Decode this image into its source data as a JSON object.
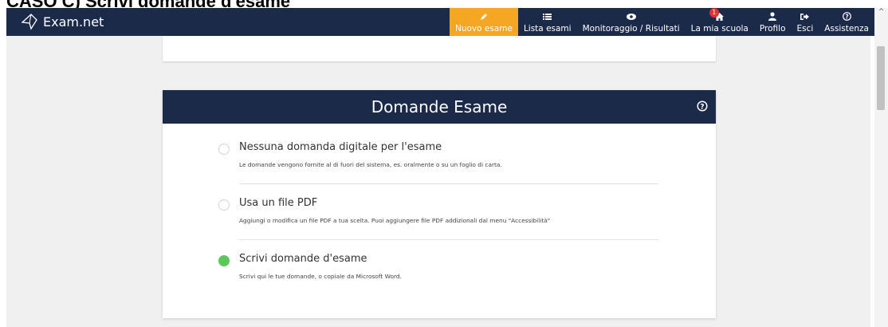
{
  "document": {
    "heading": "CASO C) Scrivi domande d'esame"
  },
  "app": {
    "logo_text": "Exam.net"
  },
  "nav": {
    "items": [
      {
        "label": "Nuovo esame",
        "icon": "pencil-icon"
      },
      {
        "label": "Lista esami",
        "icon": "list-icon"
      },
      {
        "label": "Monitoraggio / Risultati",
        "icon": "eye-icon"
      },
      {
        "label": "La mia scuola",
        "icon": "home-icon",
        "badge": "1"
      },
      {
        "label": "Profilo",
        "icon": "user-icon"
      },
      {
        "label": "Esci",
        "icon": "sign-out-icon"
      },
      {
        "label": "Assistenza",
        "icon": "help-circle-icon"
      }
    ],
    "active_index": 0
  },
  "section": {
    "title": "Domande Esame",
    "help_icon": "help-circle-icon",
    "options": [
      {
        "title": "Nessuna domanda digitale per l'esame",
        "description": "Le domande vengono fornite al di fuori del sistema, es. oralmente o su un foglio di carta.",
        "selected": false
      },
      {
        "title": "Usa un file PDF",
        "description": "Aggiungi o modifica un file PDF a tua scelta. Puoi aggiungere file PDF addizionali dal menu \"Accessibilità\"",
        "selected": false
      },
      {
        "title": "Scrivi domande d'esame",
        "description": "Scrivi qui le tue domande, o copiale da Microsoft Word.",
        "selected": true
      }
    ]
  },
  "colors": {
    "nav_bg": "#1c2a4a",
    "active_tab": "#f5a623",
    "radio_selected": "#5ac85a",
    "badge": "#e03131"
  }
}
